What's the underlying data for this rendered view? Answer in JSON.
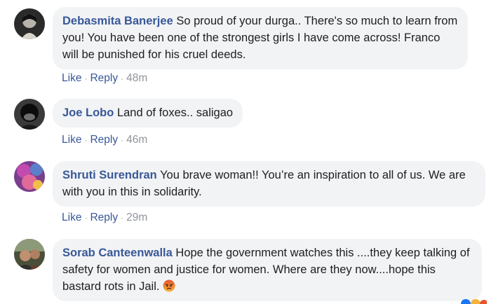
{
  "comments": [
    {
      "author": "Debasmita Banerjee",
      "text": "So proud of your durga.. There's so much to learn from you! You have been one of the strongest girls I have come across! Franco will be punished for his cruel deeds.",
      "like": "Like",
      "reply": "Reply",
      "time": "48m"
    },
    {
      "author": "Joe Lobo",
      "text": "Land of foxes.. saligao",
      "like": "Like",
      "reply": "Reply",
      "time": "46m"
    },
    {
      "author": "Shruti Surendran",
      "text": "You brave woman!! You’re an inspiration to all of us. We are with you in this in solidarity.",
      "like": "Like",
      "reply": "Reply",
      "time": "29m"
    },
    {
      "author": "Sorab Canteenwalla",
      "text": "Hope the government watches this ....they keep talking of safety for women and justice for women. Where are they now....hope this bastard rots in Jail.",
      "emoji": "angry-face-emoji"
    }
  ],
  "separator": "·",
  "colors": {
    "author": "#385898",
    "bubble": "#f2f3f5",
    "meta": "#90949c",
    "text": "#1c1e21"
  }
}
